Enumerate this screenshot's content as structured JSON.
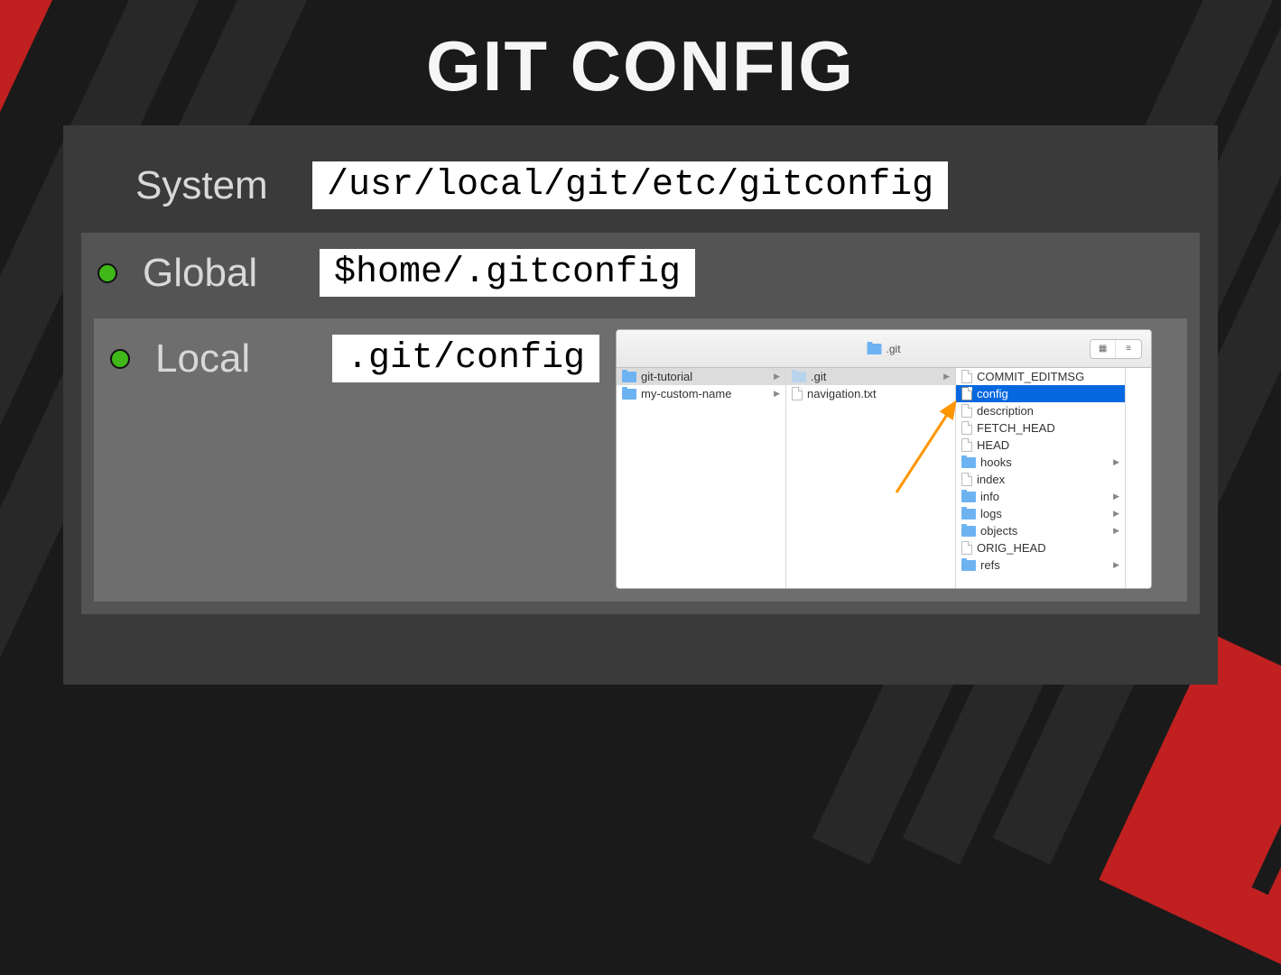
{
  "title": "GIT CONFIG",
  "levels": {
    "system": {
      "label": "System",
      "path": "/usr/local/git/etc/gitconfig"
    },
    "global": {
      "label": "Global",
      "path": "$home/.gitconfig"
    },
    "local": {
      "label": "Local",
      "path": ".git/config"
    }
  },
  "finder": {
    "title": ".git",
    "columns": [
      {
        "items": [
          {
            "name": "git-tutorial",
            "type": "folder",
            "selected": "gray",
            "hasChildren": true
          },
          {
            "name": "my-custom-name",
            "type": "folder",
            "hasChildren": true
          }
        ]
      },
      {
        "items": [
          {
            "name": ".git",
            "type": "folder-dim",
            "selected": "gray",
            "hasChildren": true
          },
          {
            "name": "navigation.txt",
            "type": "file"
          }
        ]
      },
      {
        "items": [
          {
            "name": "COMMIT_EDITMSG",
            "type": "file"
          },
          {
            "name": "config",
            "type": "file",
            "selected": "blue"
          },
          {
            "name": "description",
            "type": "file"
          },
          {
            "name": "FETCH_HEAD",
            "type": "file"
          },
          {
            "name": "HEAD",
            "type": "file"
          },
          {
            "name": "hooks",
            "type": "folder",
            "hasChildren": true
          },
          {
            "name": "index",
            "type": "file"
          },
          {
            "name": "info",
            "type": "folder",
            "hasChildren": true
          },
          {
            "name": "logs",
            "type": "folder",
            "hasChildren": true
          },
          {
            "name": "objects",
            "type": "folder",
            "hasChildren": true
          },
          {
            "name": "ORIG_HEAD",
            "type": "file"
          },
          {
            "name": "refs",
            "type": "folder",
            "hasChildren": true
          }
        ]
      }
    ]
  }
}
